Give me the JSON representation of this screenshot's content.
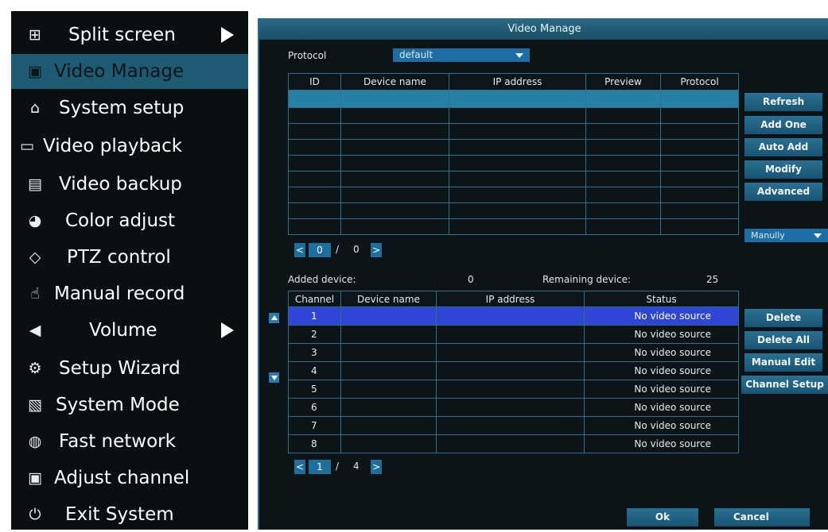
{
  "menu": {
    "items": [
      {
        "label": "Split screen",
        "icon": "grid-icon",
        "glyph": "⊞",
        "has_arrow": true,
        "active": false
      },
      {
        "label": "Video Manage",
        "icon": "camera-icon",
        "glyph": "▣",
        "has_arrow": false,
        "active": true
      },
      {
        "label": "System setup",
        "icon": "home-icon",
        "glyph": "⌂",
        "has_arrow": false,
        "active": false
      },
      {
        "label": "Video playback",
        "icon": "film-icon",
        "glyph": "▭",
        "has_arrow": false,
        "active": false
      },
      {
        "label": "Video backup",
        "icon": "save-icon",
        "glyph": "▤",
        "has_arrow": false,
        "active": false
      },
      {
        "label": "Color adjust",
        "icon": "palette-icon",
        "glyph": "◕",
        "has_arrow": false,
        "active": false
      },
      {
        "label": "PTZ control",
        "icon": "ptz-icon",
        "glyph": "◇",
        "has_arrow": false,
        "active": false
      },
      {
        "label": "Manual record",
        "icon": "hand-icon",
        "glyph": "☝",
        "has_arrow": false,
        "active": false
      },
      {
        "label": "Volume",
        "icon": "speaker-icon",
        "glyph": "◀",
        "has_arrow": true,
        "active": false
      },
      {
        "label": "Setup Wizard",
        "icon": "gears-icon",
        "glyph": "⚙",
        "has_arrow": false,
        "active": false
      },
      {
        "label": "System Mode",
        "icon": "document-icon",
        "glyph": "▧",
        "has_arrow": false,
        "active": false
      },
      {
        "label": "Fast network",
        "icon": "globe-icon",
        "glyph": "◍",
        "has_arrow": false,
        "active": false
      },
      {
        "label": "Adjust channel",
        "icon": "camera-icon",
        "glyph": "▣",
        "has_arrow": false,
        "active": false
      },
      {
        "label": "Exit System",
        "icon": "power-icon",
        "glyph": "⏻",
        "has_arrow": false,
        "active": false
      }
    ]
  },
  "dialog": {
    "title": "Video Manage",
    "protocol_label": "Protocol",
    "protocol_value": "default",
    "device_table": {
      "headers": [
        "ID",
        "Device name",
        "IP address",
        "Preview",
        "Protocol"
      ],
      "row_count": 9
    },
    "side_buttons": [
      "Refresh",
      "Add One",
      "Auto Add",
      "Modify",
      "Advanced"
    ],
    "mode_select": "Manully",
    "pager1": {
      "prev": "<",
      "page": "0",
      "sep": "/",
      "total": "0",
      "next": ">"
    },
    "added_label": "Added device:",
    "added_value": "0",
    "remaining_label": "Remaining device:",
    "remaining_value": "25",
    "channel_table": {
      "headers": [
        "Channel",
        "Device name",
        "IP address",
        "Status"
      ],
      "rows": [
        {
          "channel": "1",
          "device": "",
          "ip": "",
          "status": "No video source"
        },
        {
          "channel": "2",
          "device": "",
          "ip": "",
          "status": "No video source"
        },
        {
          "channel": "3",
          "device": "",
          "ip": "",
          "status": "No video source"
        },
        {
          "channel": "4",
          "device": "",
          "ip": "",
          "status": "No video source"
        },
        {
          "channel": "5",
          "device": "",
          "ip": "",
          "status": "No video source"
        },
        {
          "channel": "6",
          "device": "",
          "ip": "",
          "status": "No video source"
        },
        {
          "channel": "7",
          "device": "",
          "ip": "",
          "status": "No video source"
        },
        {
          "channel": "8",
          "device": "",
          "ip": "",
          "status": "No video source"
        }
      ]
    },
    "channel_buttons": [
      "Delete",
      "Delete All",
      "Manual Edit",
      "Channel Setup"
    ],
    "pager2": {
      "prev": "<",
      "page": "1",
      "sep": "/",
      "total": "4",
      "next": ">"
    },
    "ok_label": "Ok",
    "cancel_label": "Cancel"
  },
  "colors": {
    "menu_bg": "#0a0f12",
    "menu_active": "#1e5a72",
    "dialog_bg": "#0d1418",
    "selected_row": "#277fa3",
    "selected_channel_row": "#2f45d6",
    "button": "#1a5474"
  }
}
